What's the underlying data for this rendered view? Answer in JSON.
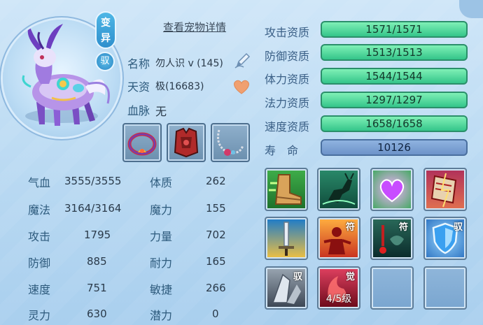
{
  "pet": {
    "badge_transform": "变异",
    "badge_tame": "驭",
    "detail_link": "查看宠物详情",
    "name_label": "名称",
    "name_value": "勿人识 v (145)",
    "talent_label": "天资",
    "talent_value": "极(16683)",
    "bloodline_label": "血脉",
    "bloodline_value": "无"
  },
  "equipment": [
    "collar-ring-icon",
    "armor-icon",
    "necklace-icon"
  ],
  "aptitudes": [
    {
      "label": "攻击资质",
      "value": "1571/1571"
    },
    {
      "label": "防御资质",
      "value": "1513/1513"
    },
    {
      "label": "体力资质",
      "value": "1544/1544"
    },
    {
      "label": "法力资质",
      "value": "1297/1297"
    },
    {
      "label": "速度资质",
      "value": "1658/1658"
    }
  ],
  "lifespan": {
    "label": "寿　命",
    "value": "10126"
  },
  "stats_left": [
    {
      "label": "气血",
      "value": "3555/3555"
    },
    {
      "label": "魔法",
      "value": "3164/3164"
    },
    {
      "label": "攻击",
      "value": "1795"
    },
    {
      "label": "防御",
      "value": "885"
    },
    {
      "label": "速度",
      "value": "751"
    },
    {
      "label": "灵力",
      "value": "630"
    }
  ],
  "stats_right": [
    {
      "label": "体质",
      "value": "262"
    },
    {
      "label": "魔力",
      "value": "155"
    },
    {
      "label": "力量",
      "value": "702"
    },
    {
      "label": "耐力",
      "value": "165"
    },
    {
      "label": "敏捷",
      "value": "266"
    },
    {
      "label": "潜力",
      "value": "0"
    }
  ],
  "skills": {
    "tags": {
      "fu1": "符",
      "fu2": "符",
      "yu1": "驭",
      "yu2": "驭",
      "jue": "觉"
    },
    "awaken_level": "4/5级"
  }
}
